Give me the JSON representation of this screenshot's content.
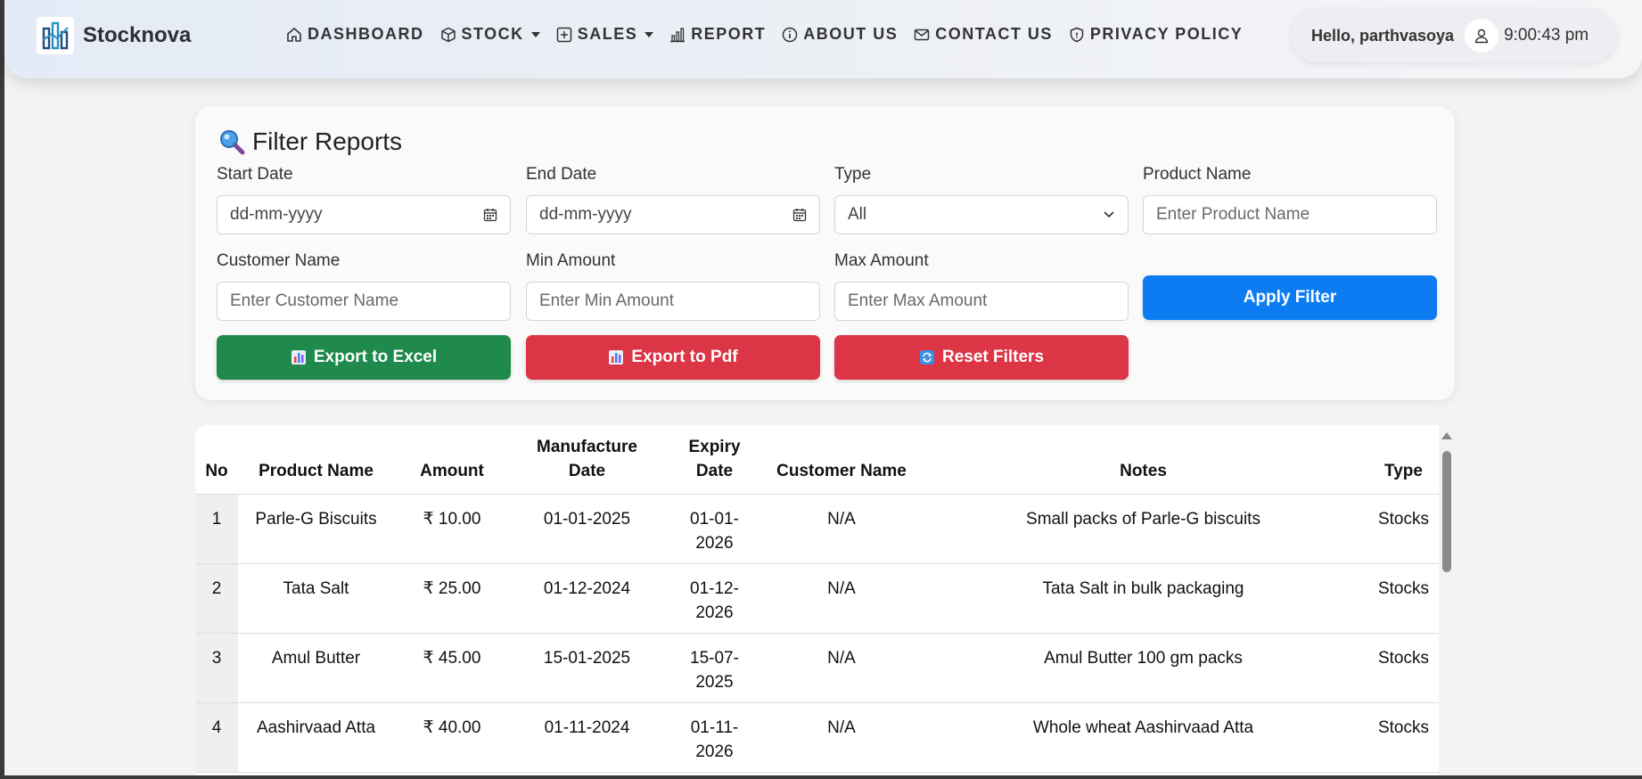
{
  "brand": {
    "name": "Stocknova",
    "logo_icon": "building-chart-icon"
  },
  "nav": {
    "items": [
      {
        "label": "DASHBOARD",
        "icon": "home-icon",
        "dropdown": false
      },
      {
        "label": "STOCK",
        "icon": "box-icon",
        "dropdown": true
      },
      {
        "label": "SALES",
        "icon": "plus-square-icon",
        "dropdown": true
      },
      {
        "label": "REPORT",
        "icon": "bar-chart-icon",
        "dropdown": false
      },
      {
        "label": "ABOUT US",
        "icon": "info-circle-icon",
        "dropdown": false
      },
      {
        "label": "CONTACT US",
        "icon": "envelope-icon",
        "dropdown": false
      },
      {
        "label": "PRIVACY POLICY",
        "icon": "shield-icon",
        "dropdown": false
      }
    ]
  },
  "user": {
    "greeting": "Hello, parthvasoya",
    "time": "9:00:43 pm",
    "avatar_icon": "person-icon"
  },
  "filter": {
    "title": "Filter Reports",
    "title_icon": "magnifier-icon",
    "start_date": {
      "label": "Start Date",
      "value": "dd-mm-yyyy"
    },
    "end_date": {
      "label": "End Date",
      "value": "dd-mm-yyyy"
    },
    "type": {
      "label": "Type",
      "value": "All"
    },
    "product_name": {
      "label": "Product Name",
      "placeholder": "Enter Product Name"
    },
    "customer_name": {
      "label": "Customer Name",
      "placeholder": "Enter Customer Name"
    },
    "min_amount": {
      "label": "Min Amount",
      "placeholder": "Enter Min Amount"
    },
    "max_amount": {
      "label": "Max Amount",
      "placeholder": "Enter Max Amount"
    },
    "apply_label": "Apply Filter",
    "export_excel_label": "Export to Excel",
    "export_pdf_label": "Export to Pdf",
    "reset_label": "Reset Filters"
  },
  "colors": {
    "green": "#1f8a4c",
    "red": "#dc3545",
    "blue": "#0d7cf2"
  },
  "table": {
    "headers": {
      "no": "No",
      "product": "Product Name",
      "amount": "Amount",
      "mfg_1": "Manufacture",
      "mfg_2": "Date",
      "exp_1": "Expiry",
      "exp_2": "Date",
      "customer": "Customer Name",
      "notes": "Notes",
      "type": "Type"
    },
    "rows": [
      {
        "no": "1",
        "product": "Parle-G Biscuits",
        "amount": "₹ 10.00",
        "mfg": "01-01-2025",
        "exp_1": "01-01-",
        "exp_2": "2026",
        "customer": "N/A",
        "notes": "Small packs of Parle-G biscuits",
        "type": "Stocks"
      },
      {
        "no": "2",
        "product": "Tata Salt",
        "amount": "₹ 25.00",
        "mfg": "01-12-2024",
        "exp_1": "01-12-",
        "exp_2": "2026",
        "customer": "N/A",
        "notes": "Tata Salt in bulk packaging",
        "type": "Stocks"
      },
      {
        "no": "3",
        "product": "Amul Butter",
        "amount": "₹ 45.00",
        "mfg": "15-01-2025",
        "exp_1": "15-07-",
        "exp_2": "2025",
        "customer": "N/A",
        "notes": "Amul Butter 100 gm packs",
        "type": "Stocks"
      },
      {
        "no": "4",
        "product": "Aashirvaad Atta",
        "amount": "₹ 40.00",
        "mfg": "01-11-2024",
        "exp_1": "01-11-",
        "exp_2": "2026",
        "customer": "N/A",
        "notes": "Whole wheat Aashirvaad Atta",
        "type": "Stocks"
      }
    ]
  }
}
